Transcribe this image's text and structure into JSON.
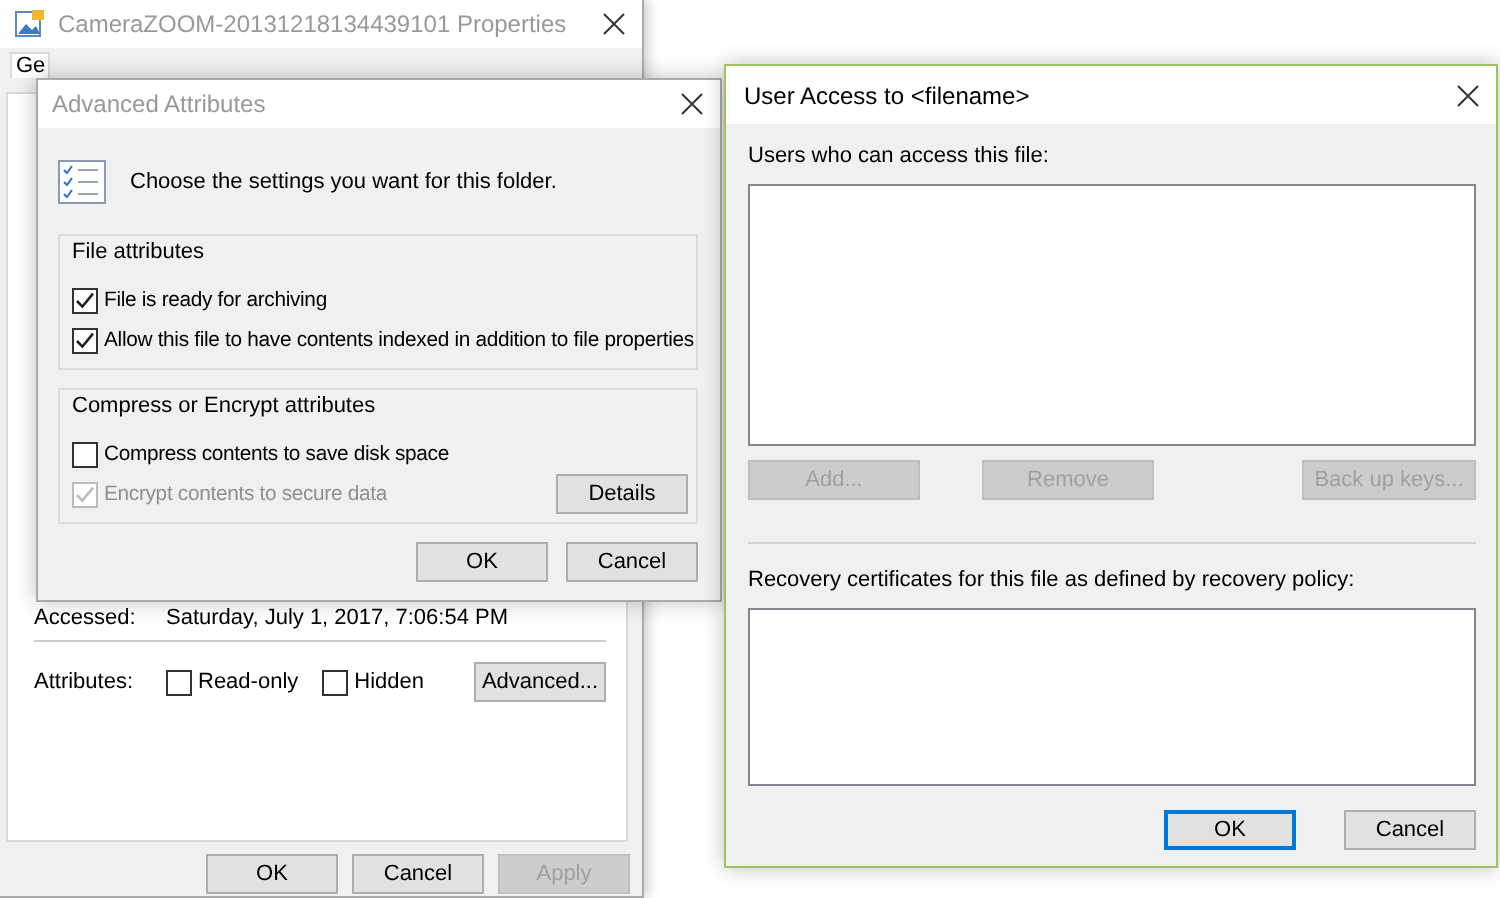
{
  "properties_window": {
    "title": "CameraZOOM-20131218134439101 Properties",
    "tabs": [
      {
        "label": "Ge",
        "selected": true
      }
    ],
    "accessed_label": "Accessed:",
    "accessed_value": "Saturday, July 1, 2017, 7:06:54 PM",
    "attributes_label": "Attributes:",
    "attributes": [
      {
        "label": "Read-only",
        "checked": false
      },
      {
        "label": "Hidden",
        "checked": false
      }
    ],
    "advanced_button": "Advanced...",
    "buttons": [
      {
        "label": "OK",
        "disabled": false
      },
      {
        "label": "Cancel",
        "disabled": false
      },
      {
        "label": "Apply",
        "disabled": true
      }
    ]
  },
  "advanced_attributes": {
    "title": "Advanced Attributes",
    "instruction": "Choose the settings you want for this folder.",
    "groups": [
      {
        "title": "File attributes",
        "options": [
          {
            "label": "File is ready for archiving",
            "checked": true,
            "disabled": false
          },
          {
            "label": "Allow this file to have contents indexed in addition to file properties",
            "checked": true,
            "disabled": false
          }
        ]
      },
      {
        "title": "Compress or Encrypt attributes",
        "options": [
          {
            "label": "Compress contents to save disk space",
            "checked": false,
            "disabled": false
          },
          {
            "label": "Encrypt contents to secure data",
            "checked": true,
            "disabled": true
          }
        ],
        "button": "Details"
      }
    ],
    "buttons": [
      {
        "label": "OK",
        "disabled": false
      },
      {
        "label": "Cancel",
        "disabled": false
      }
    ]
  },
  "user_access": {
    "title": "User Access to <filename>",
    "users_label": "Users who can access this file:",
    "user_buttons": [
      {
        "label": "Add...",
        "disabled": true
      },
      {
        "label": "Remove",
        "disabled": true
      },
      {
        "label": "Back up keys...",
        "disabled": true
      }
    ],
    "recovery_label": "Recovery certificates for this file as defined by recovery policy:",
    "buttons": [
      {
        "label": "OK",
        "focused": true
      },
      {
        "label": "Cancel",
        "focused": false
      }
    ]
  }
}
